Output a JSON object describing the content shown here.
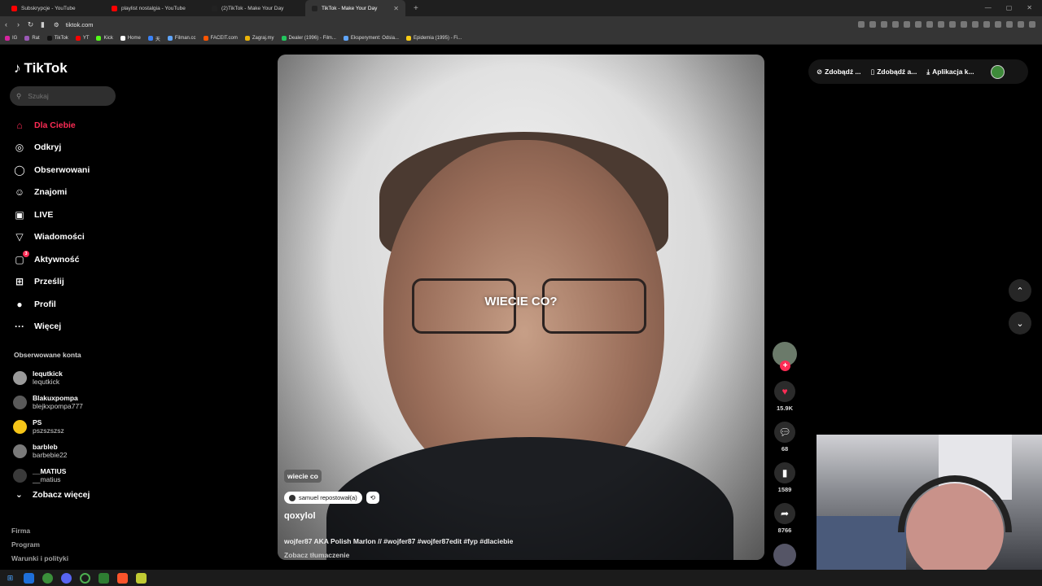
{
  "browser": {
    "tabs": [
      {
        "title": "Subskrypcje - YouTube",
        "color": "#ff0000",
        "active": false
      },
      {
        "title": "playlist nostalgia - YouTube",
        "color": "#ff0000",
        "active": false
      },
      {
        "title": "(2)TikTok - Make Your Day",
        "color": "#222222",
        "active": false
      },
      {
        "title": "TikTok - Make Your Day",
        "color": "#222222",
        "active": true
      }
    ],
    "url": "tiktok.com",
    "bookmarks": [
      {
        "label": "IG",
        "color": "#d6249f"
      },
      {
        "label": "Rat",
        "color": "#9b59b6"
      },
      {
        "label": "TikTok",
        "color": "#111111"
      },
      {
        "label": "YT",
        "color": "#ff0000"
      },
      {
        "label": "Kick",
        "color": "#53fc18"
      },
      {
        "label": "Home",
        "color": "#ffffff"
      },
      {
        "label": "天",
        "color": "#3b82f6"
      },
      {
        "label": "Filman.cc",
        "color": "#60a5fa"
      },
      {
        "label": "FACEIT.com",
        "color": "#ff5500"
      },
      {
        "label": "Zagraj.my",
        "color": "#eab308"
      },
      {
        "label": "Dealer (1996) - Film...",
        "color": "#22c55e"
      },
      {
        "label": "Eksperyment: Odsia...",
        "color": "#60a5fa"
      },
      {
        "label": "Epidemia (1995) - Fi...",
        "color": "#facc15"
      }
    ]
  },
  "app": {
    "logo": "TikTok",
    "search_placeholder": "Szukaj",
    "nav": [
      {
        "label": "Dla Ciebie",
        "icon": "home-icon",
        "glyph": "⌂",
        "active": true
      },
      {
        "label": "Odkryj",
        "icon": "compass-icon",
        "glyph": "◎",
        "active": false
      },
      {
        "label": "Obserwowani",
        "icon": "following-avatar-icon",
        "glyph": "◯",
        "active": false
      },
      {
        "label": "Znajomi",
        "icon": "friends-icon",
        "glyph": "☺",
        "active": false
      },
      {
        "label": "LIVE",
        "icon": "live-tv-icon",
        "glyph": "▣",
        "active": false
      },
      {
        "label": "Wiadomości",
        "icon": "send-icon",
        "glyph": "▽",
        "active": false
      },
      {
        "label": "Aktywność",
        "icon": "inbox-icon",
        "glyph": "▢",
        "active": false,
        "badge": "3"
      },
      {
        "label": "Prześlij",
        "icon": "upload-icon",
        "glyph": "⊞",
        "active": false
      },
      {
        "label": "Profil",
        "icon": "profile-avatar-icon",
        "glyph": "●",
        "active": false
      },
      {
        "label": "Więcej",
        "icon": "more-icon",
        "glyph": "···",
        "active": false
      }
    ],
    "following_title": "Obserwowane konta",
    "following": [
      {
        "name": "lequtkick",
        "handle": "lequtkick",
        "color": "#9a9a9a"
      },
      {
        "name": "Blakuxpompa",
        "handle": "blejkxpompa777",
        "color": "#5a5a5a"
      },
      {
        "name": "PS",
        "handle": "pszszszsz",
        "color": "#f5c518"
      },
      {
        "name": "barbleb",
        "handle": "barbebie22",
        "color": "#7a7a7a"
      },
      {
        "name": "__MATIUS",
        "handle": "__matius",
        "color": "#3a3a3a"
      }
    ],
    "see_more": "Zobacz więcej",
    "footer": [
      "Firma",
      "Program",
      "Warunki i polityki"
    ]
  },
  "video": {
    "caption": "WIECIE CO?",
    "tag": "wiecie co",
    "repost_text": "samuel repostował(a)",
    "author": "qoxylol",
    "description": "wojfer87 AKA Polish Marlon // #wojfer87 #wojfer87edit #fyp #dlaciebie",
    "translate": "Zobacz tłumaczenie",
    "progress": 0.12,
    "likes": "15.9K",
    "comments": "68",
    "saves": "1589",
    "shares": "8766"
  },
  "topbar": {
    "btn1": "Zdobądź ...",
    "btn2": "Zdobądź a...",
    "btn3": "Aplikacja k..."
  }
}
